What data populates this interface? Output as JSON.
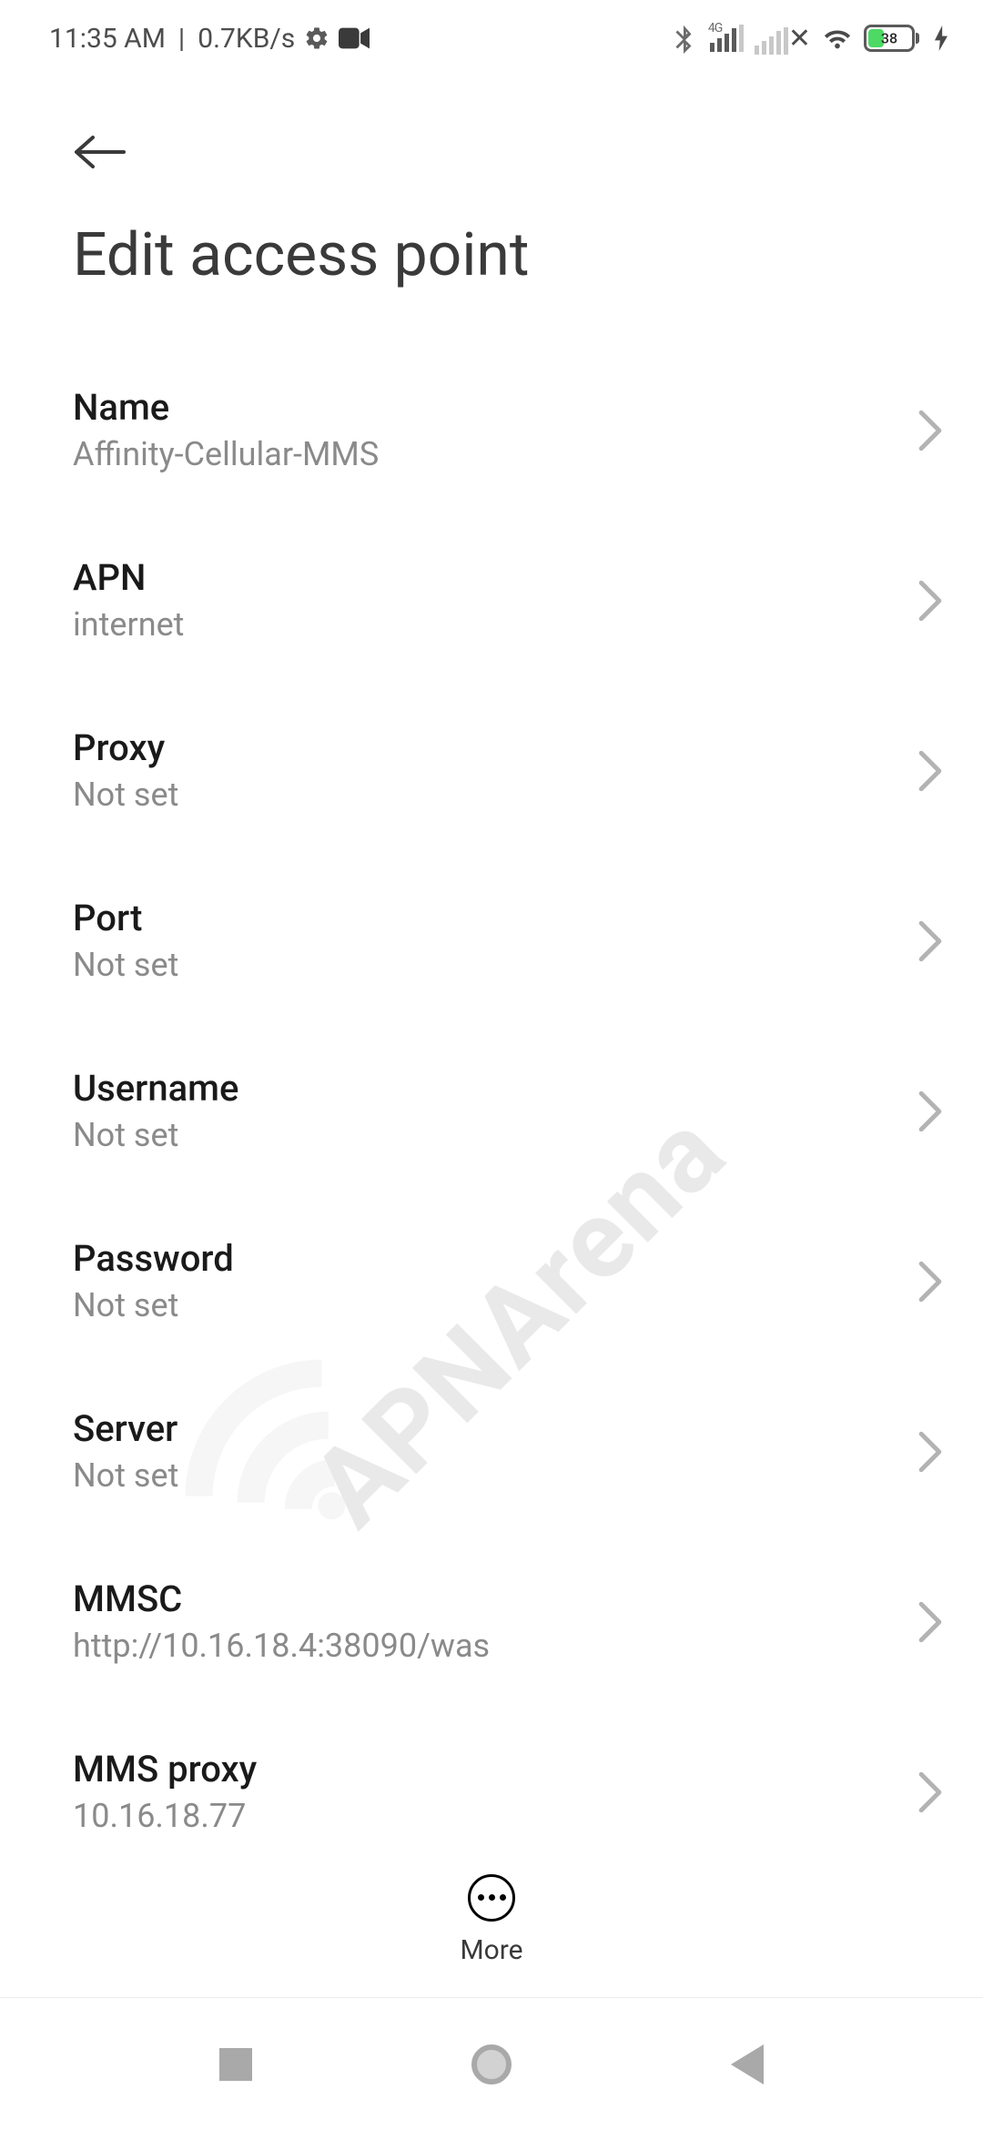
{
  "status_bar": {
    "time": "11:35 AM",
    "net_speed": "0.7KB/s",
    "mobile_label": "4G",
    "battery_pct": "38"
  },
  "header": {
    "title": "Edit access point"
  },
  "settings": [
    {
      "key": "name",
      "label": "Name",
      "value": "Affinity-Cellular-MMS"
    },
    {
      "key": "apn",
      "label": "APN",
      "value": "internet"
    },
    {
      "key": "proxy",
      "label": "Proxy",
      "value": "Not set"
    },
    {
      "key": "port",
      "label": "Port",
      "value": "Not set"
    },
    {
      "key": "username",
      "label": "Username",
      "value": "Not set"
    },
    {
      "key": "password",
      "label": "Password",
      "value": "Not set"
    },
    {
      "key": "server",
      "label": "Server",
      "value": "Not set"
    },
    {
      "key": "mmsc",
      "label": "MMSC",
      "value": "http://10.16.18.4:38090/was"
    },
    {
      "key": "mms_proxy",
      "label": "MMS proxy",
      "value": "10.16.18.77"
    }
  ],
  "bottom": {
    "more_label": "More"
  },
  "watermark_text": "APNArena"
}
